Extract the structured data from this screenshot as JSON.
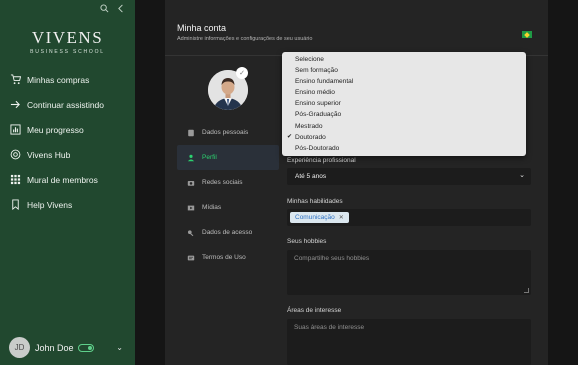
{
  "sidebar": {
    "logo": {
      "main": "VIVENS",
      "sub": "BUSINESS SCHOOL"
    },
    "top_icons": [
      "search-icon",
      "chevron-left-icon"
    ],
    "nav": [
      {
        "label": "Minhas compras",
        "icon": "cart-icon"
      },
      {
        "label": "Continuar assistindo",
        "icon": "arrow-right-icon"
      },
      {
        "label": "Meu progresso",
        "icon": "bar-chart-icon"
      },
      {
        "label": "Vivens Hub",
        "icon": "globe-icon"
      },
      {
        "label": "Mural de membros",
        "icon": "grid-icon"
      },
      {
        "label": "Help Vivens",
        "icon": "bookmark-icon"
      }
    ],
    "user": {
      "initials": "JD",
      "name": "John Doe"
    }
  },
  "header": {
    "title": "Minha conta",
    "subtitle": "Administre informações e configurações de seu usuário"
  },
  "menu": [
    {
      "label": "Dados pessoais",
      "icon": "document-icon",
      "active": false
    },
    {
      "label": "Perfil",
      "icon": "person-icon",
      "active": true
    },
    {
      "label": "Redes sociais",
      "icon": "camera-icon",
      "active": false
    },
    {
      "label": "Mídias",
      "icon": "media-icon",
      "active": false
    },
    {
      "label": "Dados de acesso",
      "icon": "key-icon",
      "active": false
    },
    {
      "label": "Termos de Uso",
      "icon": "terms-icon",
      "active": false
    }
  ],
  "form": {
    "experience": {
      "label": "Experiência profissional",
      "value": "Até 5 anos"
    },
    "skills": {
      "label": "Minhas habilidades",
      "chips": [
        "Comunicação"
      ]
    },
    "hobbies": {
      "label": "Seus hobbies",
      "placeholder": "Compartilhe seus hobbies"
    },
    "interests": {
      "label": "Áreas de interesse",
      "placeholder": "Suas áreas de interesse"
    }
  },
  "dropdown": {
    "options": [
      "Selecione",
      "Sem formação",
      "Ensino fundamental",
      "Ensino médio",
      "Ensino superior",
      "Pós-Graduação",
      "Mestrado",
      "Doutorado",
      "Pós-Doutorado"
    ],
    "selected": "Doutorado"
  },
  "colors": {
    "sidebar": "#21482f",
    "accent": "#2bd06f"
  }
}
